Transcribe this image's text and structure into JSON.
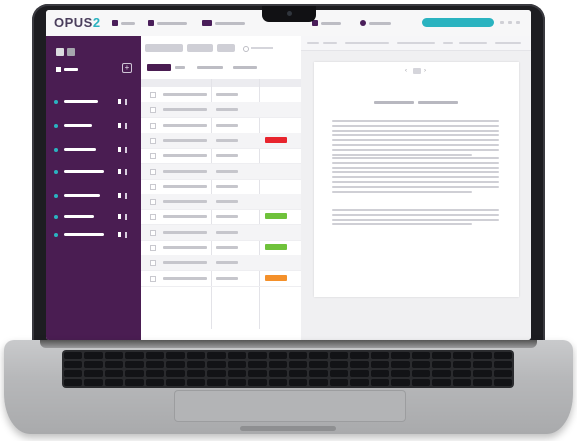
{
  "app": {
    "logo_main": "OPUS",
    "logo_accent": "2",
    "nav": [
      {
        "icon": "home-icon"
      },
      {
        "icon": "folder-icon"
      },
      {
        "icon": "users-icon"
      },
      {
        "icon": "heart-icon"
      },
      {
        "icon": "search-icon"
      }
    ],
    "sidebar_plus": "+",
    "pager_prev": "‹",
    "pager_next": "›"
  },
  "list": {
    "row_count": 13,
    "tags": [
      {
        "row": 4,
        "color": "#e8242d"
      },
      {
        "row": 9,
        "color": "#6fc23b"
      },
      {
        "row": 11,
        "color": "#6fc23b"
      },
      {
        "row": 13,
        "color": "#f4902a"
      }
    ]
  },
  "colors": {
    "brand_purple": "#4a1d52",
    "accent_teal": "#2ab3c0",
    "tag_red": "#e8242d",
    "tag_green": "#6fc23b",
    "tag_orange": "#f4902a"
  }
}
